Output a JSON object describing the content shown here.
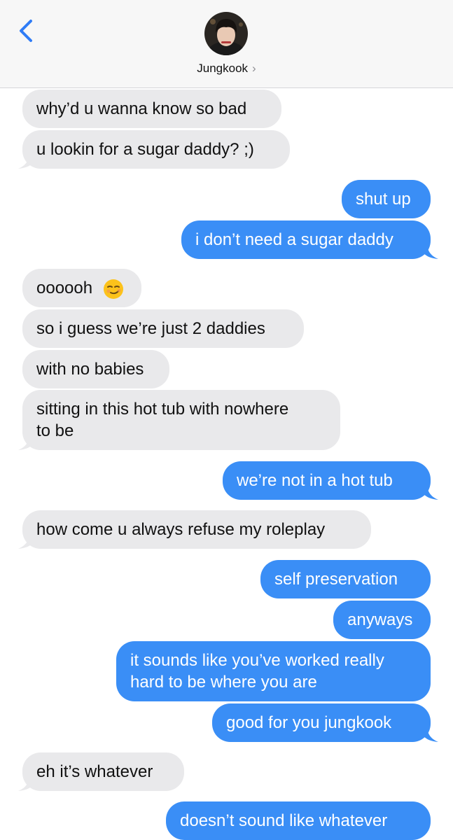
{
  "header": {
    "contact_name": "Jungkook",
    "chevron": "›",
    "back_icon": "chevron-left-icon"
  },
  "colors": {
    "incoming_bubble": "#e9e9eb",
    "outgoing_bubble": "#3a8ef6",
    "accent": "#2f7cf6"
  },
  "messages": [
    {
      "side": "in",
      "text": "why’d u wanna know so bad"
    },
    {
      "side": "in",
      "text": "u lookin for a sugar daddy? ;)"
    },
    {
      "side": "out",
      "text": "shut up"
    },
    {
      "side": "out",
      "text": "i don’t need a sugar daddy"
    },
    {
      "side": "in",
      "text": "oooooh",
      "emoji": "smirking-face-emoji"
    },
    {
      "side": "in",
      "text": "so i guess we’re just 2 daddies"
    },
    {
      "side": "in",
      "text": "with no babies"
    },
    {
      "side": "in",
      "line1": "sitting in this hot tub with nowhere",
      "line2": "to be"
    },
    {
      "side": "out",
      "text": "we’re not in a hot tub"
    },
    {
      "side": "in",
      "text": "how come u always refuse my roleplay"
    },
    {
      "side": "out",
      "text": "self preservation"
    },
    {
      "side": "out",
      "text": "anyways"
    },
    {
      "side": "out",
      "line1": "it sounds like you’ve worked really",
      "line2": "hard to be where you are"
    },
    {
      "side": "out",
      "text": "good for you jungkook"
    },
    {
      "side": "in",
      "text": "eh it’s whatever"
    },
    {
      "side": "out",
      "text": "doesn’t sound like whatever"
    }
  ]
}
